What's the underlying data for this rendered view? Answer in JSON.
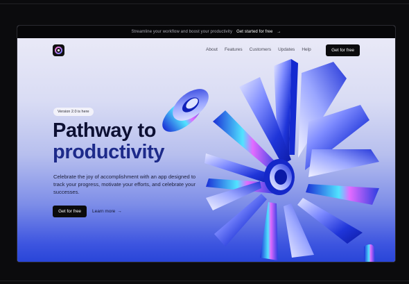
{
  "announcement": {
    "text": "Streamline your workflow and boost your productivity",
    "cta": "Get started for free",
    "arrow": "→"
  },
  "nav": {
    "items": [
      "About",
      "Features",
      "Customers",
      "Updates",
      "Help"
    ],
    "cta": "Get for free"
  },
  "hero": {
    "badge": "Version 2.0 is here",
    "title_line1": "Pathway to",
    "title_line2": "productivity",
    "description": "Celebrate the joy of accomplishment with an app designed to track your progress, motivate your efforts, and celebrate your successes.",
    "primary_cta": "Get for free",
    "secondary_cta": "Learn more",
    "secondary_arrow": "→"
  },
  "colors": {
    "accent_blue": "#2945d8",
    "dark": "#0b0b0d",
    "hero_top": "#e9e9f7"
  },
  "icons": [
    "logo-icon",
    "arrow-right-icon",
    "ring-3d-icon",
    "starburst-3d-icon"
  ]
}
